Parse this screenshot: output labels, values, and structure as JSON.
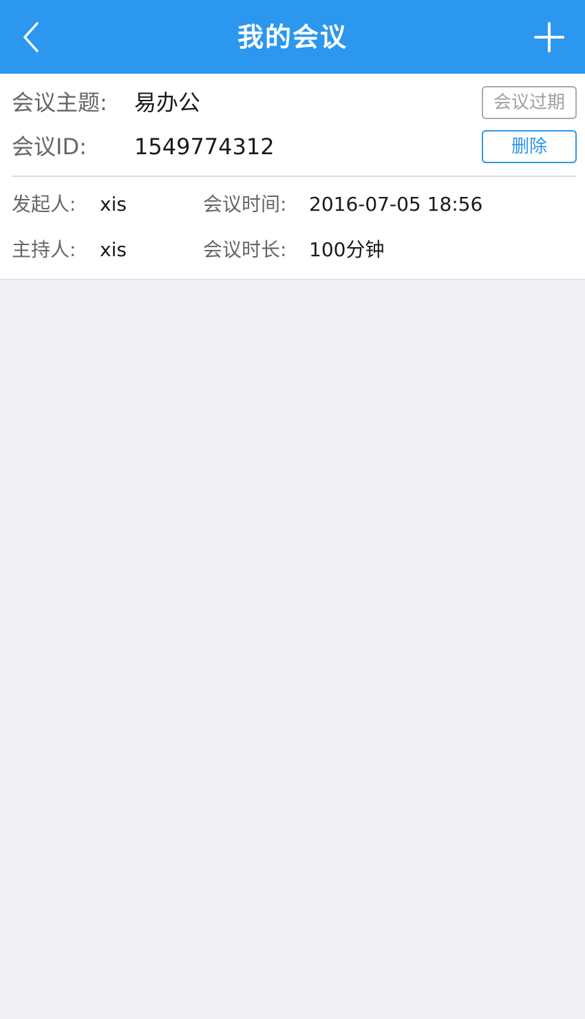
{
  "header": {
    "title": "我的会议",
    "back_icon": "chevron-left-icon",
    "add_icon": "plus-icon",
    "background": "#2b97ee"
  },
  "meeting": {
    "topic_label": "会议主题:",
    "topic_value": "易办公",
    "id_label": "会议ID:",
    "id_value": "1549774312",
    "status_badge": "会议过期",
    "delete_label": "删除",
    "initiator_label": "发起人:",
    "initiator_value": "xis",
    "host_label": "主持人:",
    "host_value": "xis",
    "time_label": "会议时间:",
    "time_value": "2016-07-05 18:56",
    "duration_label": "会议时长:",
    "duration_value": "100分钟"
  },
  "colors": {
    "accent": "#2b97ee",
    "page_background": "#efeff4",
    "badge_gray": "#a0a0a0"
  }
}
